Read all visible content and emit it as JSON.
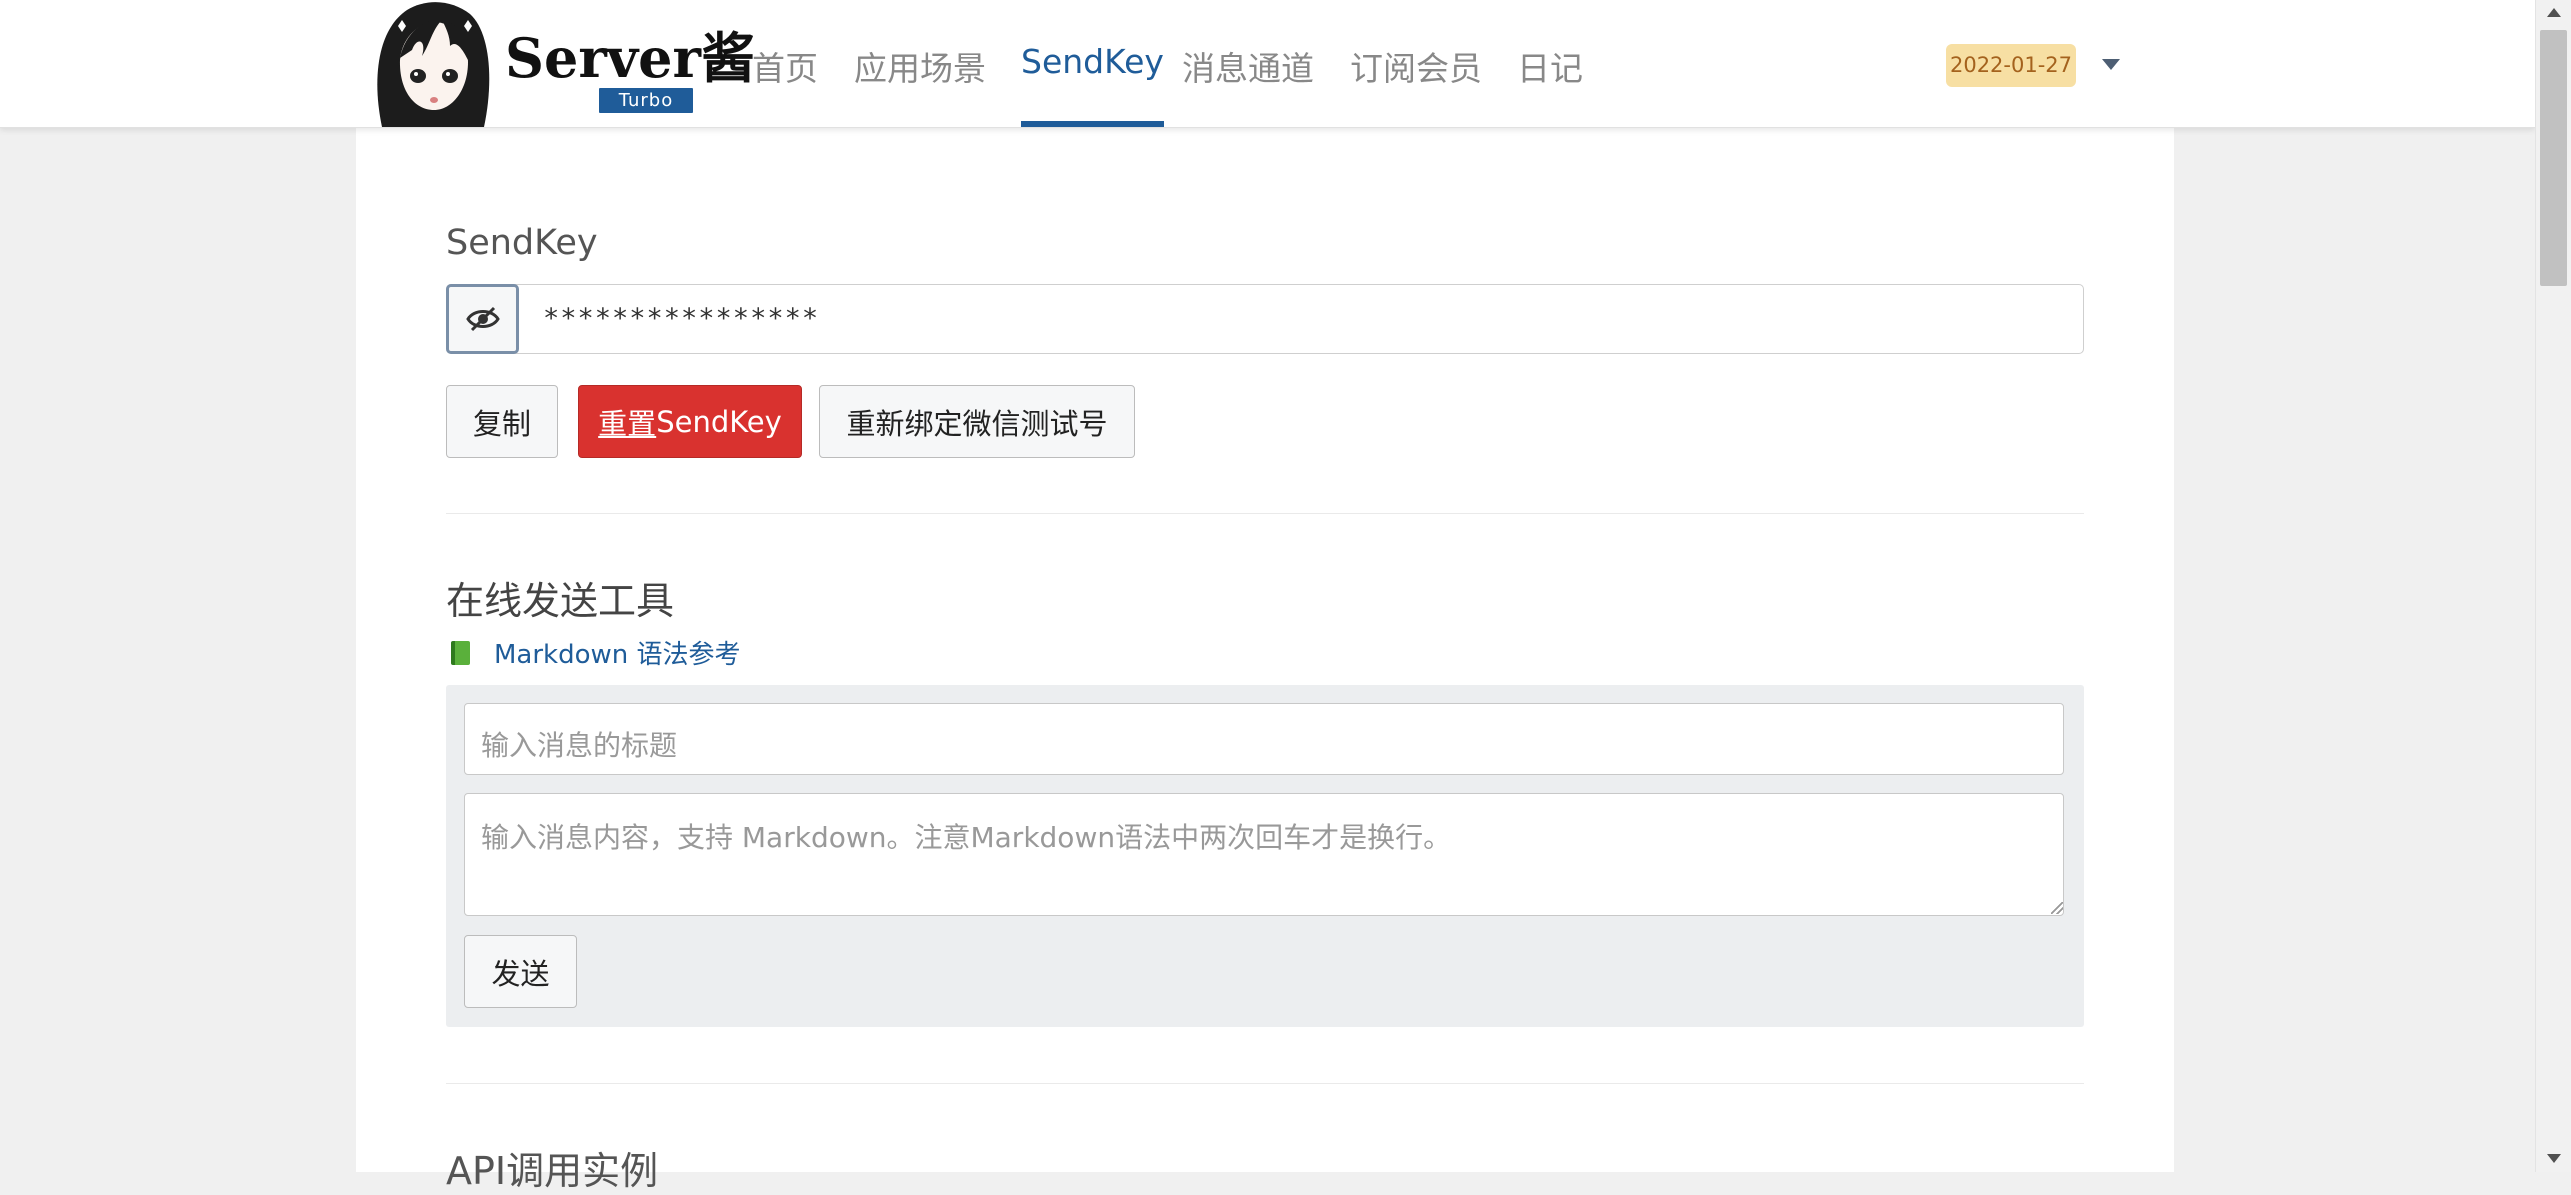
{
  "header": {
    "brand": "Server酱",
    "badge": "Turbo",
    "nav": [
      {
        "label": "首页"
      },
      {
        "label": "应用场景"
      },
      {
        "label": "SendKey"
      },
      {
        "label": "消息通道"
      },
      {
        "label": "订阅会员"
      },
      {
        "label": "日记"
      }
    ],
    "active_nav": "SendKey",
    "date": "2022-01-27"
  },
  "sendkey": {
    "label": "SendKey",
    "masked_value": "****************",
    "buttons": {
      "copy": "复制",
      "reset_prefix": "重置",
      "reset_suffix": "SendKey",
      "rebind": "重新绑定微信测试号"
    }
  },
  "online_tool": {
    "title": "在线发送工具",
    "markdown_link": "Markdown 语法参考",
    "title_placeholder": "输入消息的标题",
    "body_placeholder": "输入消息内容，支持 Markdown。注意Markdown语法中两次回车才是换行。",
    "send_button": "发送"
  },
  "api_section": {
    "title": "API调用实例"
  },
  "colors": {
    "accent": "#1f5c99",
    "danger": "#d9322f",
    "date_badge_bg": "#f7dfa3"
  }
}
